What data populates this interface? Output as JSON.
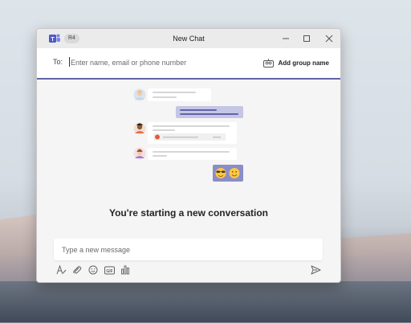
{
  "window": {
    "title": "New Chat",
    "user_initials": "R4",
    "controls": [
      "minimize",
      "maximize",
      "close"
    ]
  },
  "recipient": {
    "label": "To:",
    "placeholder": "Enter name, email or phone number",
    "value": "",
    "add_group_label": "Add group name"
  },
  "conversation": {
    "heading": "You're starting a new conversation",
    "illustration_emoji": [
      "sunglasses-emoji",
      "smiley-emoji"
    ]
  },
  "composer": {
    "placeholder": "Type a new message",
    "value": "",
    "tools": [
      "format-icon",
      "attach-icon",
      "emoji-icon",
      "gif-icon",
      "poll-icon"
    ],
    "send_icon": "send-icon"
  },
  "colors": {
    "accent": "#6264a7",
    "bubble_own": "#c5c6e6",
    "window_bg": "#f5f5f5"
  }
}
